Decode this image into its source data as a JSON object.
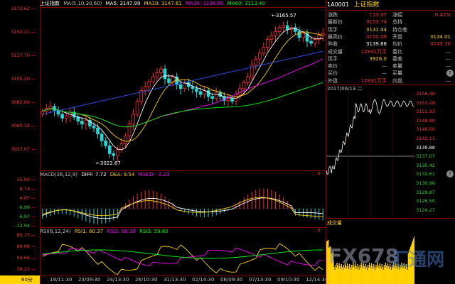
{
  "main_header": {
    "title": "上证指数",
    "ma_label": "MA(5,10,30,60)",
    "ma5": "MA5: 3147.99",
    "ma10": "MA10: 3147.61",
    "ma30": "MA30: 3136.90",
    "ma60": "MA60: 3113.40",
    "colors": {
      "ma5": "#ffffff",
      "ma10": "#ffd200",
      "ma30": "#ff00ff",
      "ma60": "#00ff00"
    }
  },
  "price_axis": [
    "3172.62",
    "3150.21",
    "3127.70",
    "3105.20",
    "3082.69",
    "3060.18",
    "3037.67"
  ],
  "price_hi_label": "3165.57",
  "price_lo_label": "3022.67",
  "macd_header": {
    "label": "MACD(26,12,9)",
    "diff": "DIFF: 7.72",
    "dea": "DEA: 9.54",
    "macd": "MACD: -3.23"
  },
  "macd_axis": [
    "15.00",
    "8.74",
    "4.87",
    "-0.99",
    "-6.97",
    "-12.94"
  ],
  "rsi_header": {
    "label": "RSI(6,12,24)",
    "rsi1": "RSI1: 60.37",
    "rsi2": "RSI2: 60.39",
    "rsi3": "RSI3: 59.60"
  },
  "rsi_axis": [
    "85.73",
    "69.69",
    "54.66",
    "38.22"
  ],
  "period": "60分",
  "x_labels": [
    "19/11:30",
    "23/09:30",
    "24/13:30",
    "26/10:30",
    "31/13:30",
    "02/14:30",
    "06/09:30",
    "07/13:30",
    "09/10:30",
    "12/14:30"
  ],
  "quote": {
    "code": "1A0001",
    "name": "上证指数",
    "rows": [
      {
        "l1": "涨跌",
        "v1": "↑13.07",
        "c1": "red",
        "l2": "涨幅",
        "v2": "0.42%",
        "c2": "red"
      },
      {
        "l1": "最新价",
        "v1": "3153.74",
        "c1": "red",
        "l2": "总持",
        "v2": "",
        "c2": "red"
      },
      {
        "l1": "现手",
        "v1": "3131.04",
        "c1": "yel",
        "l2": "持仓差",
        "v2": "",
        "c2": "red"
      },
      {
        "l1": "最高价",
        "v1": "3155.09",
        "c1": "red",
        "l2": "开盘",
        "v2": "3134.01",
        "c2": "yel"
      },
      {
        "l1": "昨收",
        "v1": "3139.88",
        "c1": "wht",
        "l2": "均价",
        "v2": "3143.70",
        "c2": "red"
      },
      {
        "l1": "成交量",
        "v1": "12831万手",
        "c1": "red",
        "l2": "委比",
        "v2": "—",
        "c2": "dash"
      },
      {
        "l1": "现手",
        "v1": "3926.0",
        "c1": "yel",
        "l2": "委差",
        "v2": "—",
        "c2": "dash"
      },
      {
        "l1": "卖价",
        "v1": "—",
        "c1": "dash",
        "l2": "卖量",
        "v2": "—",
        "c2": "dash"
      },
      {
        "l1": "买价",
        "v1": "—",
        "c1": "dash",
        "l2": "买量",
        "v2": "—",
        "c2": "dash"
      },
      {
        "l1": "外盘",
        "v1": "12831万手",
        "c1": "red",
        "l2": "内盘",
        "v2": "—",
        "c2": "dash"
      }
    ]
  },
  "intraday": {
    "date": "2017/06/13 二",
    "axis": [
      {
        "v": "3156.48",
        "c": "red"
      },
      {
        "v": "3153.28",
        "c": "red"
      },
      {
        "v": "3151.93",
        "c": "red"
      },
      {
        "v": "3148.90",
        "c": "red"
      },
      {
        "v": "3146.00",
        "c": "red"
      },
      {
        "v": "3142.11",
        "c": "red"
      },
      {
        "v": "3139.88",
        "c": "wht"
      },
      {
        "v": "3137.07",
        "c": "grn"
      },
      {
        "v": "3135.42",
        "c": "grn"
      },
      {
        "v": "3132.61",
        "c": "grn"
      },
      {
        "v": "3130.96",
        "c": "grn"
      },
      {
        "v": "3129.87",
        "c": "grn"
      },
      {
        "v": "3126.50",
        "c": "grn"
      },
      {
        "v": "3124.27",
        "c": "grn"
      }
    ],
    "volume_label": "成交量"
  },
  "watermark": {
    "text1": "FX678",
    "text2": "汇通网"
  }
}
